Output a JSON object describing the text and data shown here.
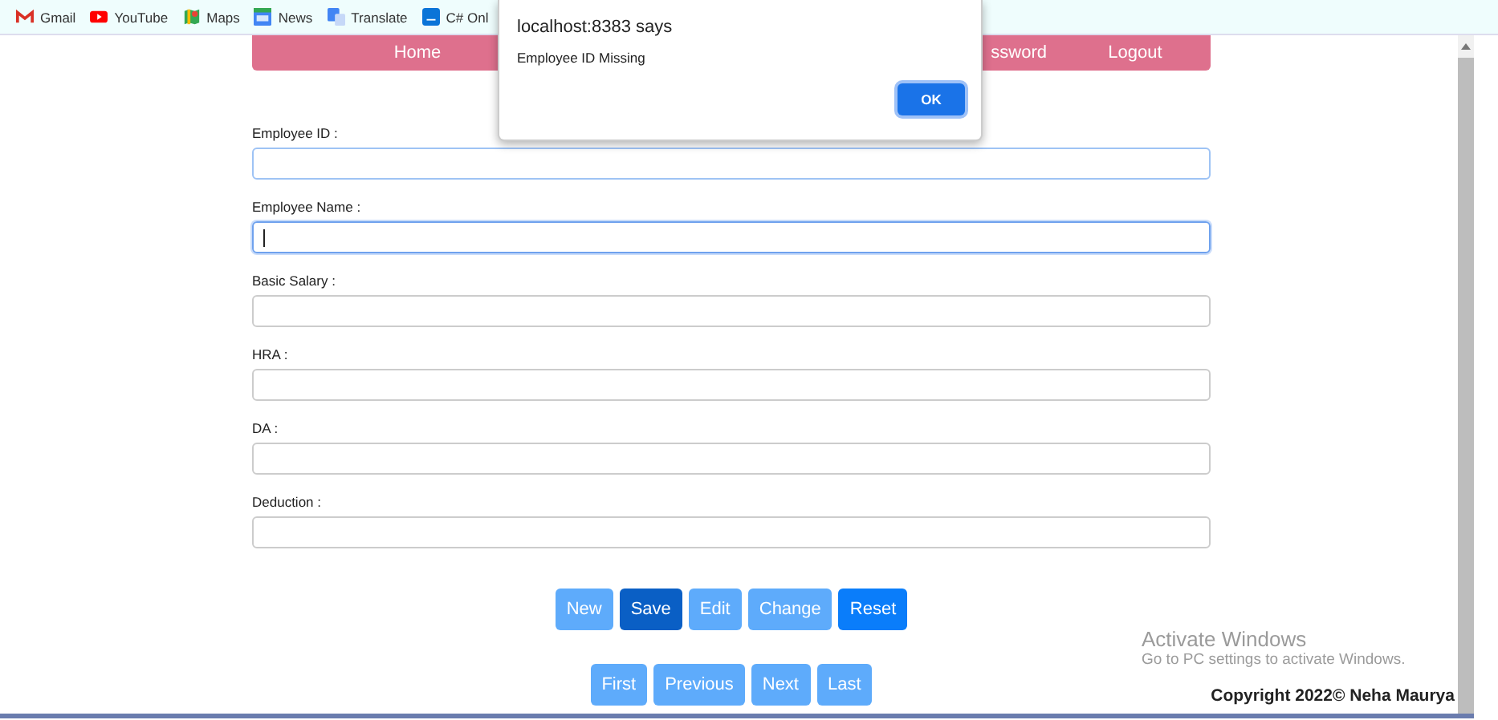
{
  "bookmarks": [
    {
      "label": "Gmail",
      "kind": "gmail"
    },
    {
      "label": "YouTube",
      "kind": "youtube"
    },
    {
      "label": "Maps",
      "kind": "maps"
    },
    {
      "label": "News",
      "kind": "news"
    },
    {
      "label": "Translate",
      "kind": "translate"
    },
    {
      "label": "C# Onl",
      "kind": "csharp"
    }
  ],
  "nav": {
    "left": "Home",
    "middle": "ssword",
    "right": "Logout"
  },
  "dialog": {
    "title": "localhost:8383 says",
    "message": "Employee ID Missing",
    "button": "OK"
  },
  "fields": [
    {
      "label": "Employee ID :",
      "focused": false,
      "highlighted": true
    },
    {
      "label": "Employee Name :",
      "focused": true,
      "highlighted": true
    },
    {
      "label": "Basic Salary :",
      "focused": false,
      "highlighted": false
    },
    {
      "label": "HRA :",
      "focused": false,
      "highlighted": false
    },
    {
      "label": "DA :",
      "focused": false,
      "highlighted": false
    },
    {
      "label": "Deduction :",
      "focused": false,
      "highlighted": false
    }
  ],
  "action_buttons": [
    {
      "label": "New",
      "kind": "light"
    },
    {
      "label": "Save",
      "kind": "dark"
    },
    {
      "label": "Edit",
      "kind": "light"
    },
    {
      "label": "Change",
      "kind": "light"
    },
    {
      "label": "Reset",
      "kind": "primary"
    }
  ],
  "navigation_buttons": [
    {
      "label": "First",
      "kind": "light"
    },
    {
      "label": "Previous",
      "kind": "light"
    },
    {
      "label": "Next",
      "kind": "light"
    },
    {
      "label": "Last",
      "kind": "light"
    }
  ],
  "activation_notice": {
    "title": "Activate Windows",
    "message": "Go to PC settings to activate Windows."
  },
  "footer": "Copyright 2022© Neha Maurya"
}
